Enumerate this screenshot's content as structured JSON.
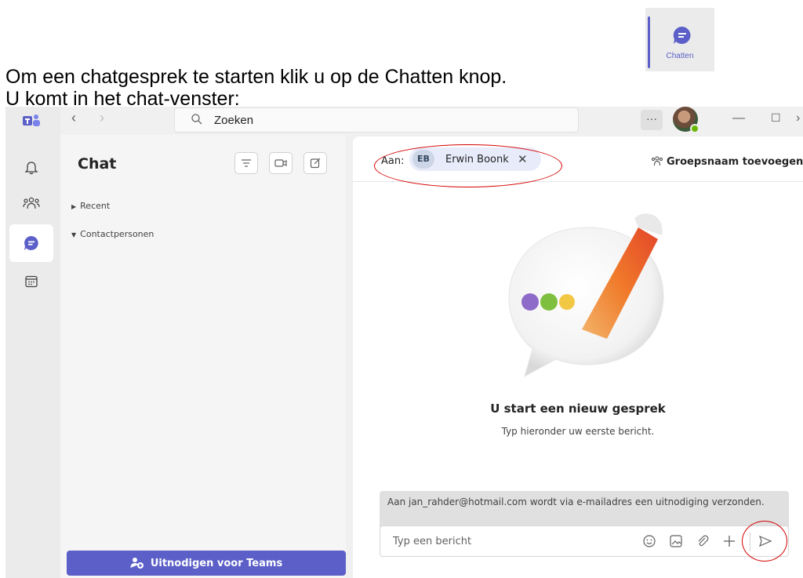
{
  "document": {
    "line1": "Om een chatgesprek te starten klik u op de Chatten knop.",
    "line2": "U komt in het chat-venster:",
    "thumbnail_label": "Chatten"
  },
  "topbar": {
    "search_placeholder": "Zoeken",
    "more_label": "···"
  },
  "rail": {
    "icons": [
      "teams-logo-icon",
      "bell-icon",
      "people-icon",
      "chat-icon",
      "calendar-icon"
    ],
    "active": "chat-icon"
  },
  "chat_list": {
    "title": "Chat",
    "sections": [
      "Recent",
      "Contactpersonen"
    ],
    "invite_label": "Uitnodigen voor Teams"
  },
  "conversation": {
    "to_label": "Aan:",
    "recipient_initials": "EB",
    "recipient_name": "Erwin Boonk",
    "group_name_label": "Groepsnaam toevoegen",
    "empty_title": "U start een nieuw gesprek",
    "empty_subtitle": "Typ hieronder uw eerste bericht.",
    "notice": "Aan jan_rahder@hotmail.com wordt via e-mailadres een uitnodiging verzonden.",
    "compose_placeholder": "Typ een bericht"
  },
  "colors": {
    "accent": "#5b5fc7",
    "annotation": "#d40000",
    "presence": "#6bb700"
  }
}
